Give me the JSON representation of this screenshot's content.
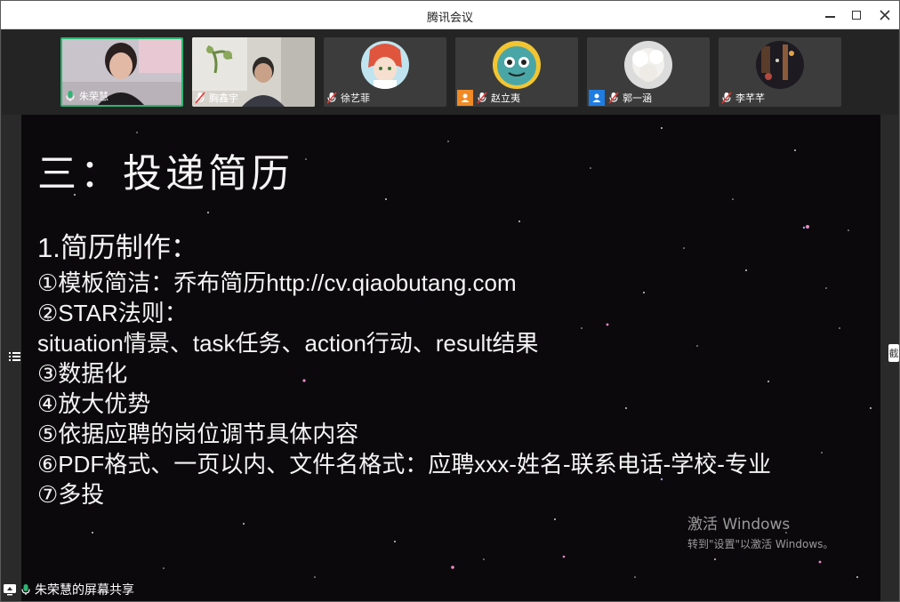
{
  "window": {
    "title": "腾讯会议"
  },
  "participants": [
    {
      "name": "朱荣慧",
      "mic": "on",
      "active": true,
      "badge": null
    },
    {
      "name": "胸鑫宇",
      "mic": "muted",
      "active": false,
      "badge": null
    },
    {
      "name": "徐艺菲",
      "mic": "muted",
      "active": false,
      "badge": null
    },
    {
      "name": "赵立夷",
      "mic": "muted",
      "active": false,
      "badge": "orange"
    },
    {
      "name": "郭一涵",
      "mic": "muted",
      "active": false,
      "badge": "blue"
    },
    {
      "name": "李芊芊",
      "mic": "muted",
      "active": false,
      "badge": null
    }
  ],
  "slide": {
    "title": "三：投递简历",
    "heading": "1.简历制作：",
    "lines": [
      "①模板简洁：乔布简历http://cv.qiaobutang.com",
      "②STAR法则：",
      "situation情景、task任务、action行动、result结果",
      "③数据化",
      "④放大优势",
      "⑤依据应聘的岗位调节具体内容",
      "⑥PDF格式、一页以内、文件名格式：应聘xxx-姓名-联系电话-学校-专业",
      "⑦多投"
    ]
  },
  "watermark": {
    "line1": "激活 Windows",
    "line2": "转到\"设置\"以激活 Windows。"
  },
  "share_status": "朱荣慧的屏幕共享",
  "right_tab": "截",
  "colors": {
    "active_border": "#2bb673",
    "mic_on": "#2bb673",
    "badge_orange": "#f08a24",
    "badge_blue": "#1f7ce0"
  }
}
